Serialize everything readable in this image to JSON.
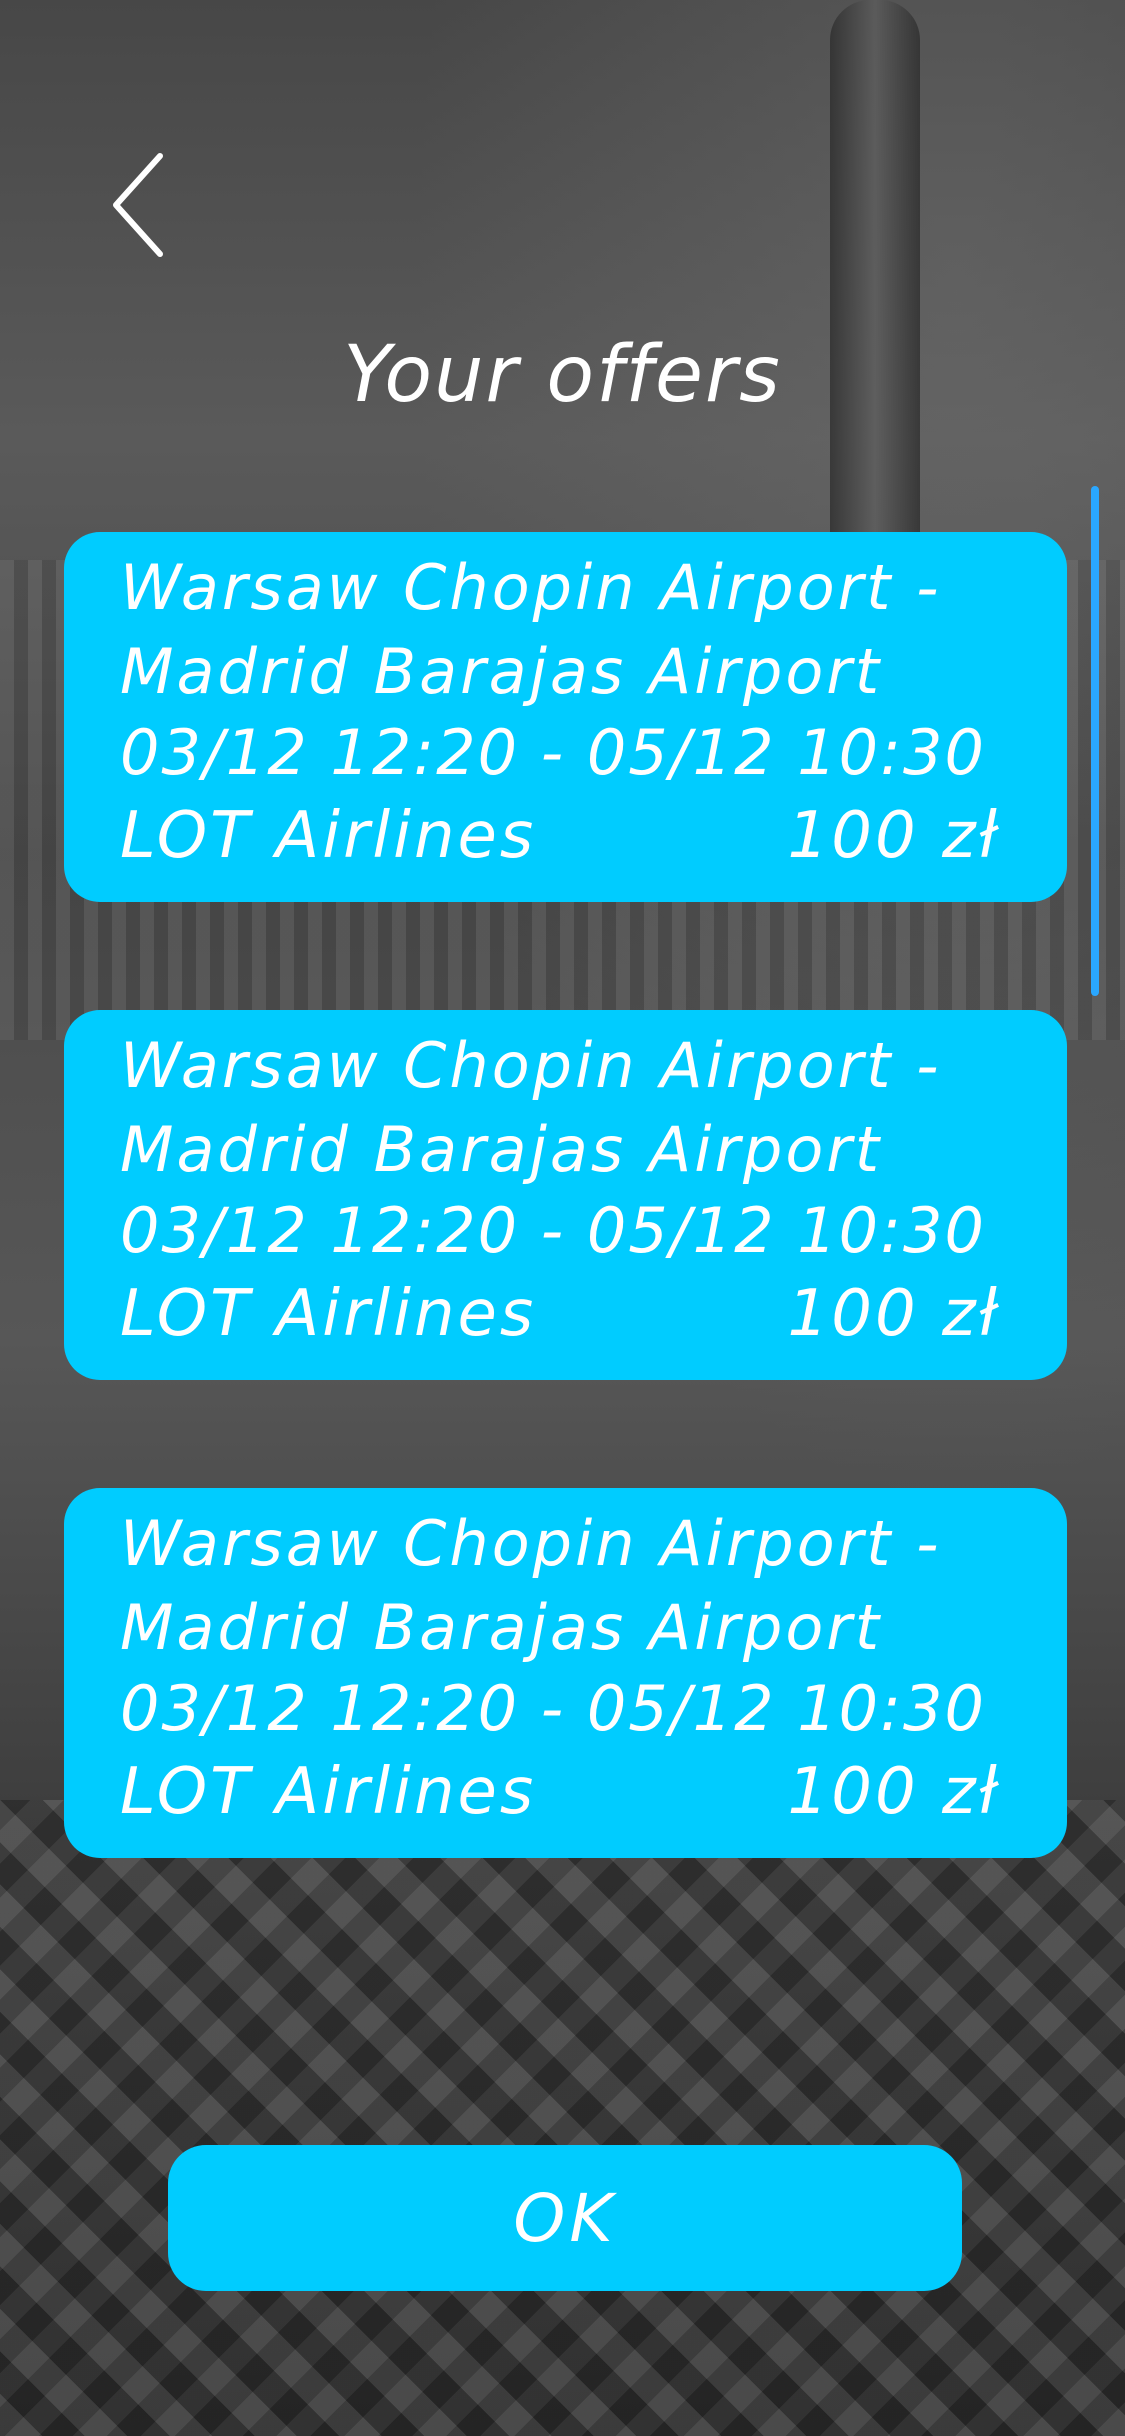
{
  "header": {
    "back_icon": "chevron-left-icon",
    "title": "Your offers"
  },
  "offers": [
    {
      "origin": "Warsaw Chopin Airport -",
      "destination": "Madrid Barajas Airport",
      "dates": "03/12 12:20 - 05/12 10:30",
      "airline": "LOT Airlines",
      "price": "100 zł"
    },
    {
      "origin": "Warsaw Chopin Airport -",
      "destination": "Madrid Barajas Airport",
      "dates": "03/12 12:20 - 05/12 10:30",
      "airline": "LOT Airlines",
      "price": "100 zł"
    },
    {
      "origin": "Warsaw Chopin Airport -",
      "destination": "Madrid Barajas Airport",
      "dates": "03/12 12:20 - 05/12 10:30",
      "airline": "LOT Airlines",
      "price": "100 zł"
    }
  ],
  "footer": {
    "ok_label": "OK"
  },
  "colors": {
    "card": "#00ccff",
    "text": "#ffffff",
    "scrollbar": "#2aa7ff"
  }
}
